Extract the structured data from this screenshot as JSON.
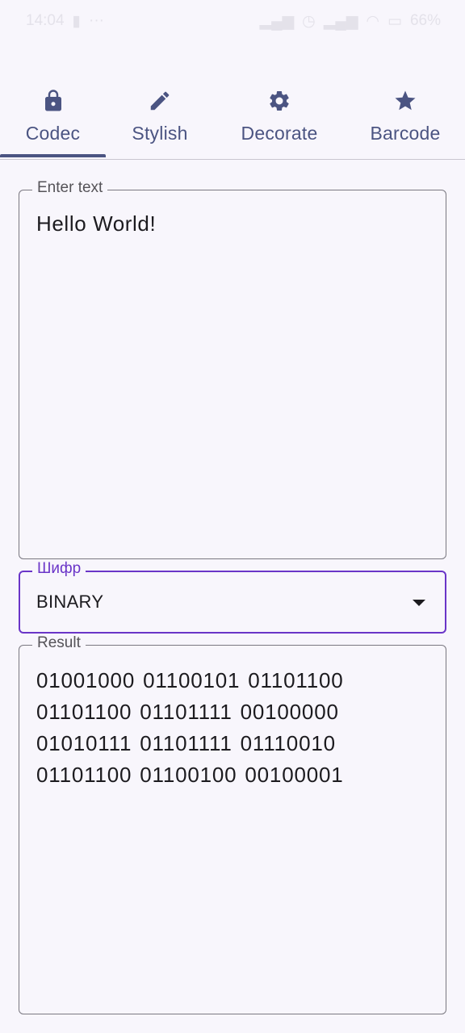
{
  "status_bar": {
    "time": "14:04",
    "battery": "66%",
    "icons": [
      "sim-icon",
      "signal-icon",
      "alarm-icon",
      "signal-icon",
      "wifi-icon",
      "battery-icon"
    ]
  },
  "tabs": [
    {
      "label": "Codec",
      "icon": "lock-icon",
      "selected": true
    },
    {
      "label": "Stylish",
      "icon": "pencil-icon",
      "selected": false
    },
    {
      "label": "Decorate",
      "icon": "gear-icon",
      "selected": false
    },
    {
      "label": "Barcode",
      "icon": "star-icon",
      "selected": false
    }
  ],
  "input": {
    "label": "Enter text",
    "value": "Hello World!"
  },
  "cipher": {
    "label": "Шифр",
    "value": "BINARY"
  },
  "result": {
    "label": "Result",
    "value": "01001000 01100101 01101100 01101100 01101111 00100000 01010111 01101111 01110010 01101100 01100100 00100001"
  },
  "colors": {
    "accent": "#6a35c8",
    "tab_color": "#4b5482",
    "background": "#f8f6fc"
  }
}
